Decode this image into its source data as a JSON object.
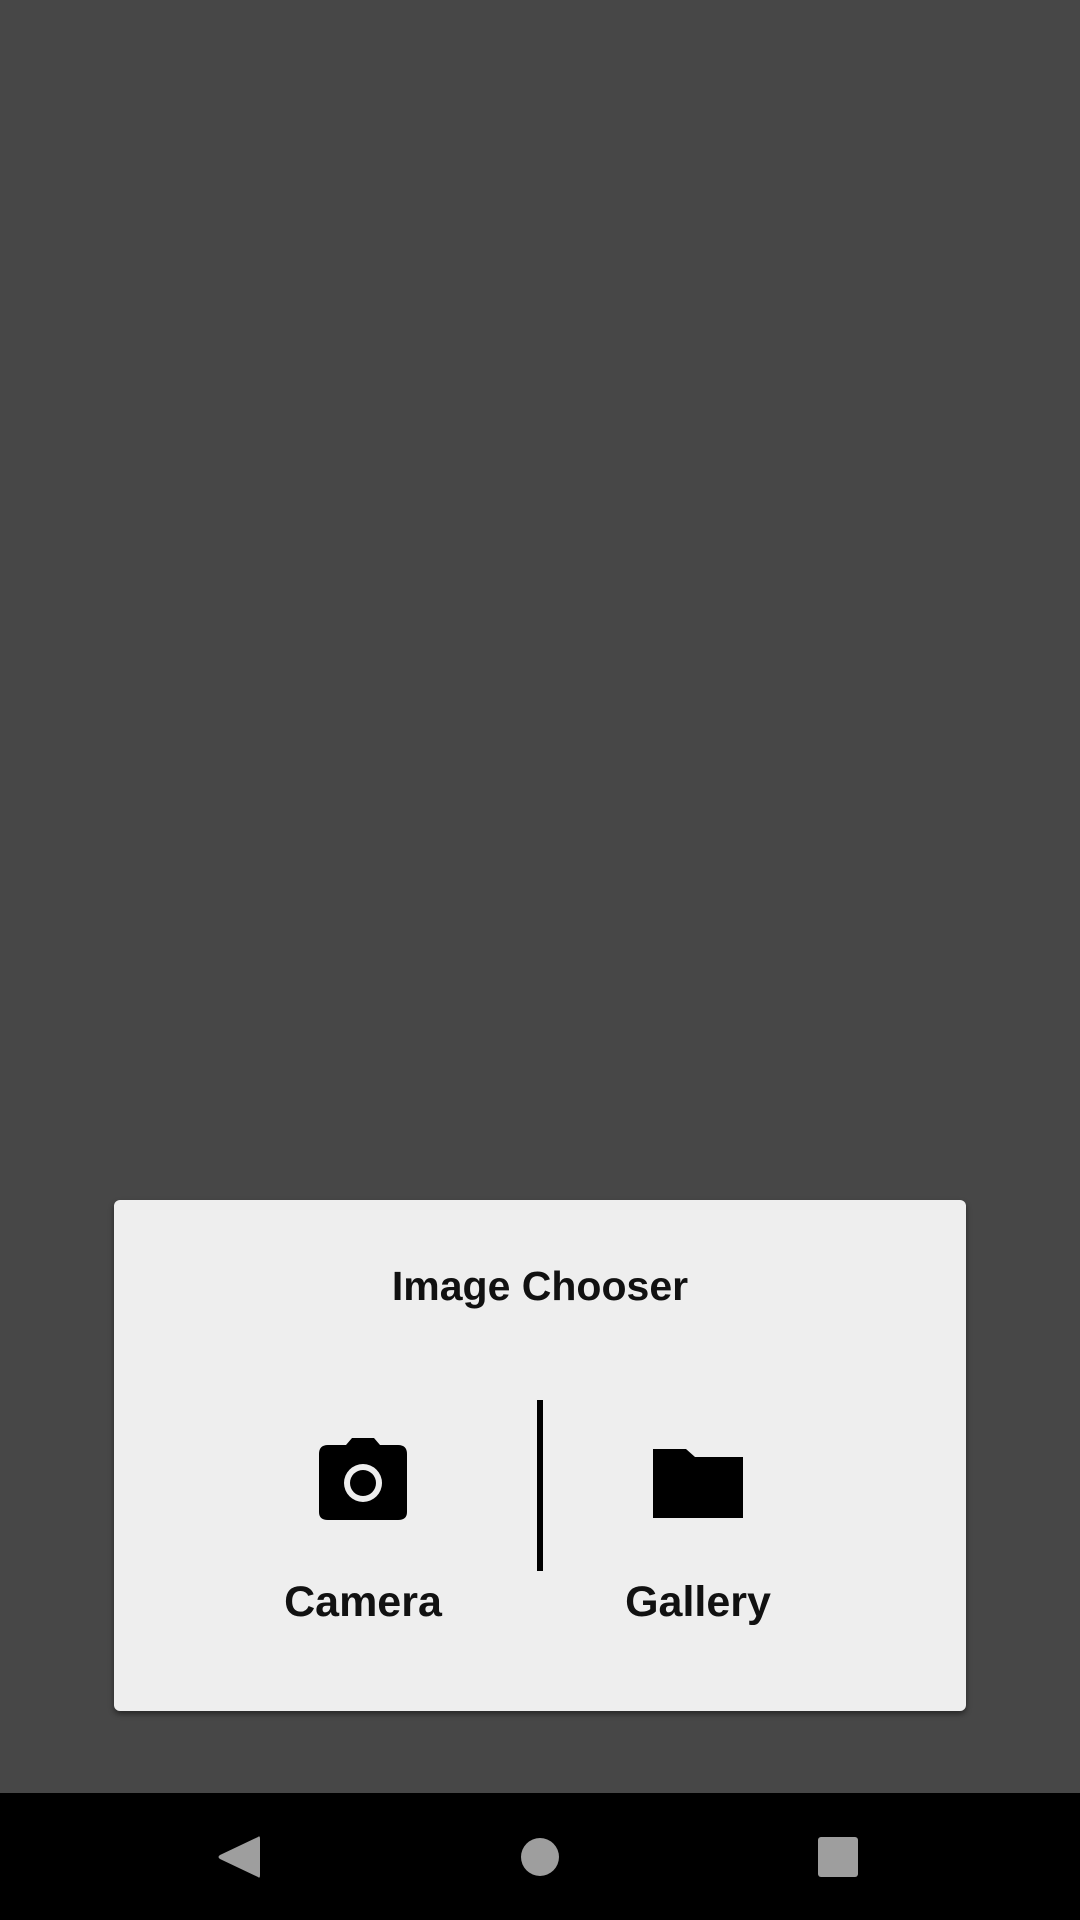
{
  "dialog": {
    "title": "Image Chooser",
    "options": [
      {
        "label": "Camera",
        "icon": "camera-icon"
      },
      {
        "label": "Gallery",
        "icon": "folder-icon"
      }
    ]
  },
  "navbar": {
    "buttons": [
      {
        "icon": "back-triangle-icon"
      },
      {
        "icon": "home-circle-icon"
      },
      {
        "icon": "recents-square-icon"
      }
    ]
  },
  "colors": {
    "scrim": "#474747",
    "dialog_bg": "#eeeeee",
    "text": "#111111",
    "navbar_bg": "#000000",
    "nav_icon": "#9e9e9e"
  }
}
